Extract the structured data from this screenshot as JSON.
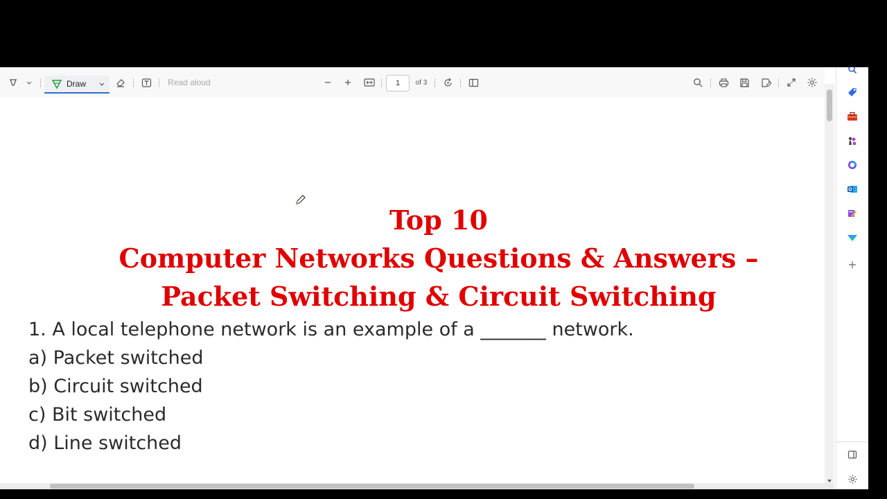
{
  "toolbar": {
    "draw_label": "Draw",
    "read_aloud_label": "Read aloud",
    "page_current": "1",
    "page_total": "of 3"
  },
  "document": {
    "title_line1": "Top 10",
    "title_line2": "Computer Networks Questions & Answers –",
    "title_line3": "Packet Switching & Circuit Switching",
    "question": "1. A local telephone network is an example of a _______ network.",
    "options": [
      "a) Packet switched",
      "b) Circuit switched",
      "c) Bit switched",
      "d) Line switched"
    ]
  },
  "colors": {
    "title": "#e00000",
    "accent": "#2f6fca"
  },
  "sidebar_icons": [
    "search-icon",
    "tag-icon",
    "toolbox-icon",
    "chess-icon",
    "copilot-icon",
    "outlook-icon",
    "designer-icon",
    "drop-icon",
    "add-icon",
    "sidebar-toggle-icon",
    "settings-icon"
  ]
}
